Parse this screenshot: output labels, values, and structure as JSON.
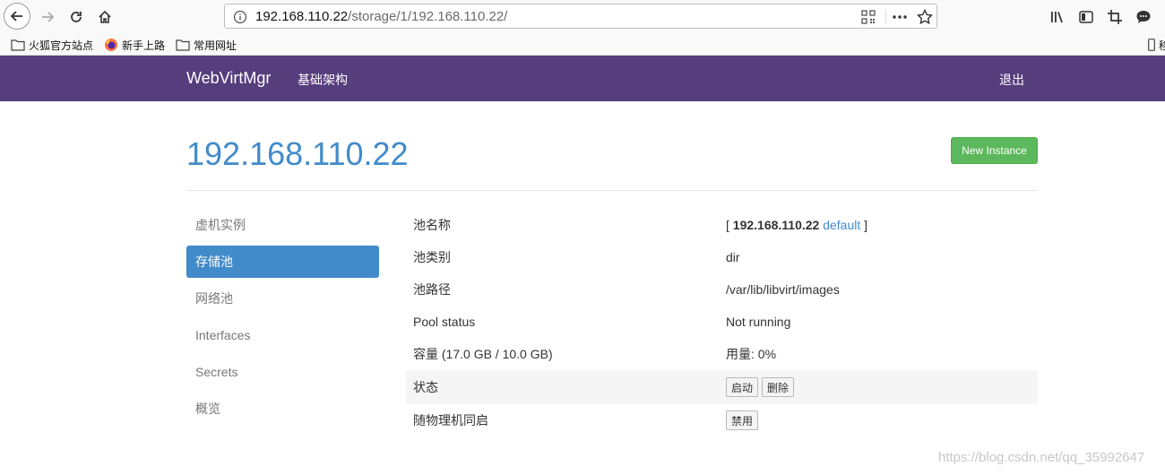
{
  "browser": {
    "url_host": "192.168.110.22",
    "url_path": "/storage/1/192.168.110.22/"
  },
  "bookmarks": [
    {
      "label": "火狐官方站点"
    },
    {
      "label": "新手上路"
    },
    {
      "label": "常用网址"
    }
  ],
  "bookmarks_overflow": "移",
  "navbar": {
    "brand": "WebVirtMgr",
    "infra_link": "基础架构",
    "logout_link": "退出"
  },
  "page": {
    "title": "192.168.110.22",
    "new_instance_label": "New Instance"
  },
  "sidebar": {
    "items": [
      {
        "label": "虚机实例"
      },
      {
        "label": "存储池"
      },
      {
        "label": "网络池"
      },
      {
        "label": "Interfaces"
      },
      {
        "label": "Secrets"
      },
      {
        "label": "概览"
      }
    ]
  },
  "details": {
    "pool_name_label": "池名称",
    "pool_name_open": "[",
    "pool_name_host": "192.168.110.22",
    "pool_name_pool": "default",
    "pool_name_close": "]",
    "pool_type_label": "池类别",
    "pool_type_value": "dir",
    "pool_path_label": "池路径",
    "pool_path_value": "/var/lib/libvirt/images",
    "pool_status_label": "Pool status",
    "pool_status_value": "Not running",
    "capacity_label": "容量 (17.0 GB / 10.0 GB)",
    "usage_value": "用量: 0%",
    "state_label": "状态",
    "start_button": "启动",
    "delete_button": "删除",
    "autostart_label": "随物理机同启",
    "disable_button": "禁用"
  },
  "watermark": "https://blog.csdn.net/qq_35992647",
  "colors": {
    "navbar": "#563d7c",
    "primary": "#428bca",
    "success": "#5cb85c"
  }
}
